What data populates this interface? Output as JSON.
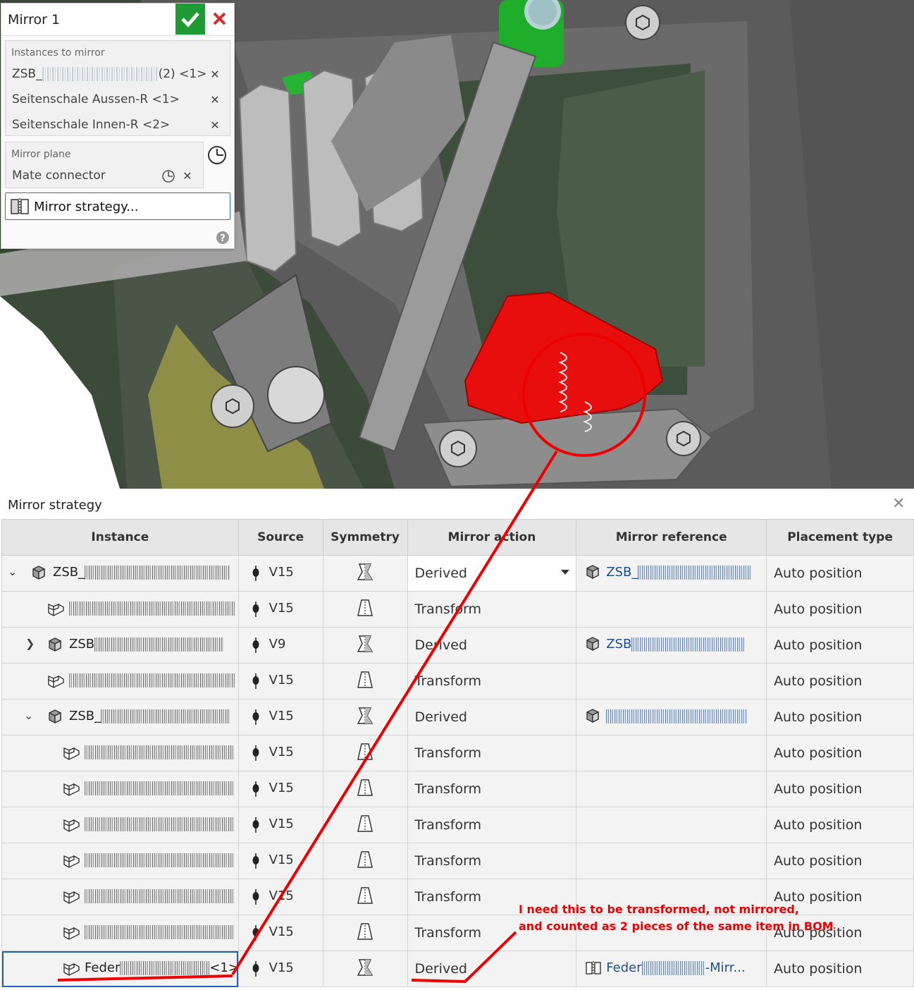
{
  "mirror_panel": {
    "title": "Mirror 1",
    "instances_label": "Instances to mirror",
    "instances": [
      {
        "prefix": "ZSB_",
        "suffix": "(2) <1>"
      },
      {
        "label": "Seitenschale Aussen-R <1>"
      },
      {
        "label": "Seitenschale Innen-R <2>"
      }
    ],
    "plane_label": "Mirror plane",
    "plane_value": "Mate connector",
    "strategy_button": "Mirror strategy..."
  },
  "strategy_dialog": {
    "title": "Mirror strategy",
    "columns": [
      "Instance",
      "Source",
      "Symmetry",
      "Mirror action",
      "Mirror reference",
      "Placement type"
    ],
    "rows": [
      {
        "expand": "down",
        "depth": 0,
        "kind": "assembly",
        "instance": "ZSB_",
        "source": "V15",
        "symmetry": "derived",
        "action": "Derived",
        "dropdown": true,
        "ref_kind": "assembly",
        "reference": "ZSB_",
        "placement": "Auto position"
      },
      {
        "expand": "",
        "depth": 1,
        "kind": "part",
        "instance": "",
        "source": "V15",
        "symmetry": "transform",
        "action": "Transform",
        "dropdown": false,
        "ref_kind": "",
        "reference": "",
        "placement": "Auto position"
      },
      {
        "expand": "right",
        "depth": 1,
        "kind": "assembly",
        "instance": "ZSB",
        "source": "V9",
        "symmetry": "derived",
        "action": "Derived",
        "dropdown": false,
        "ref_kind": "assembly",
        "reference": "ZSB",
        "placement": "Auto position"
      },
      {
        "expand": "",
        "depth": 1,
        "kind": "part",
        "instance": "",
        "source": "V15",
        "symmetry": "transform",
        "action": "Transform",
        "dropdown": false,
        "ref_kind": "",
        "reference": "",
        "placement": "Auto position"
      },
      {
        "expand": "down",
        "depth": 1,
        "kind": "assembly",
        "instance": "ZSB_",
        "source": "V15",
        "symmetry": "derived",
        "action": "Derived",
        "dropdown": false,
        "ref_kind": "assembly",
        "reference": "",
        "placement": "Auto position"
      },
      {
        "expand": "",
        "depth": 2,
        "kind": "part",
        "instance": "",
        "source": "V15",
        "symmetry": "transform",
        "action": "Transform",
        "dropdown": false,
        "ref_kind": "",
        "reference": "",
        "placement": "Auto position"
      },
      {
        "expand": "",
        "depth": 2,
        "kind": "part",
        "instance": "",
        "source": "V15",
        "symmetry": "transform",
        "action": "Transform",
        "dropdown": false,
        "ref_kind": "",
        "reference": "",
        "placement": "Auto position"
      },
      {
        "expand": "",
        "depth": 2,
        "kind": "part",
        "instance": "",
        "source": "V15",
        "symmetry": "transform",
        "action": "Transform",
        "dropdown": false,
        "ref_kind": "",
        "reference": "",
        "placement": "Auto position"
      },
      {
        "expand": "",
        "depth": 2,
        "kind": "part",
        "instance": "",
        "source": "V15",
        "symmetry": "transform",
        "action": "Transform",
        "dropdown": false,
        "ref_kind": "",
        "reference": "",
        "placement": "Auto position"
      },
      {
        "expand": "",
        "depth": 2,
        "kind": "part",
        "instance": "",
        "source": "V15",
        "symmetry": "transform",
        "action": "Transform",
        "dropdown": false,
        "ref_kind": "",
        "reference": "",
        "placement": "Auto position"
      },
      {
        "expand": "",
        "depth": 2,
        "kind": "part",
        "instance": "",
        "source": "V15",
        "symmetry": "transform",
        "action": "Transform",
        "dropdown": false,
        "ref_kind": "",
        "reference": "",
        "placement": "Auto position"
      },
      {
        "expand": "",
        "depth": 2,
        "kind": "part",
        "instance": "Feder",
        "instance_suffix": "<1>",
        "source": "V15",
        "symmetry": "derived",
        "action": "Derived",
        "dropdown": false,
        "ref_kind": "mirrored-part",
        "reference": "Feder",
        "reference_suffix": "-Mirr...",
        "placement": "Auto position",
        "selected": true
      }
    ]
  },
  "annotation": {
    "text": "I need this to be transformed, not mirrored,\nand counted as 2 pieces of the same item in BOM",
    "color": "#e00000"
  },
  "colors": {
    "accept": "#1f9b34",
    "cancel": "#d92b2b",
    "selection": "#1f5fbf",
    "reference_link": "#1c4f93",
    "highlighted_part": "#e80e0e",
    "green_part": "#1fae2b"
  }
}
